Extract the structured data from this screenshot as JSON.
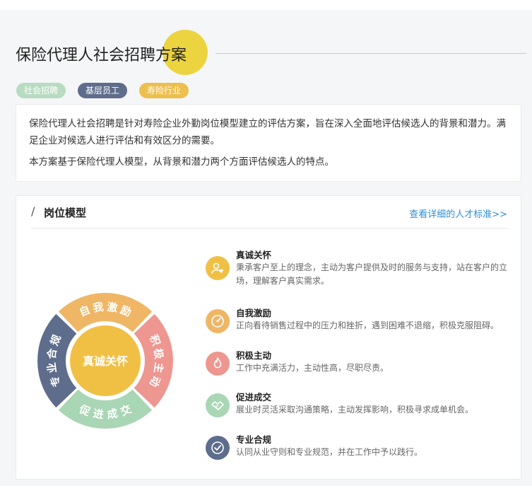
{
  "header": {
    "title": "保险代理人社会招聘方案",
    "tags": [
      {
        "label": "社会招聘",
        "bg": "#b8dcc2",
        "fg": "#ffffff"
      },
      {
        "label": "基层员工",
        "bg": "#5e6d8c",
        "fg": "#ffffff"
      },
      {
        "label": "寿险行业",
        "bg": "#edbf4e",
        "fg": "#ffffff"
      }
    ]
  },
  "intro": {
    "p1": "保险代理人社会招聘是针对寿险企业外勤岗位模型建立的评估方案，旨在深入全面地评估候选人的背景和潜力。满足企业对候选人进行评估和有效区分的需要。",
    "p2": "本方案基于保险代理人模型，从背景和潜力两个方面评估候选人的特点。"
  },
  "model": {
    "title": "岗位模型",
    "link": "查看详细的人才标准>>",
    "center_label": "真诚关怀",
    "center_color": "#f0c045",
    "ring": [
      {
        "label": "自我激励",
        "color": "#efb665"
      },
      {
        "label": "积极主动",
        "color": "#ee9690"
      },
      {
        "label": "促进成交",
        "color": "#a9d6b5"
      },
      {
        "label": "专业合规",
        "color": "#5e6d8c"
      }
    ],
    "traits": [
      {
        "name": "真诚关怀",
        "desc": "秉承客户至上的理念，主动为客户提供及时的服务与支持，站在客户的立场，理解客户真实需求。",
        "color": "#f0c045",
        "icon": "person-heart-icon"
      },
      {
        "name": "自我激励",
        "desc": "正向看待销售过程中的压力和挫折，遇到困难不退缩，积极克服阻碍。",
        "color": "#efb665",
        "icon": "gauge-icon"
      },
      {
        "name": "积极主动",
        "desc": "工作中充满活力，主动性高，尽职尽责。",
        "color": "#ee9690",
        "icon": "flame-icon"
      },
      {
        "name": "促进成交",
        "desc": "展业时灵活采取沟通策略，主动发挥影响，积极寻求成单机会。",
        "color": "#a9d6b5",
        "icon": "handshake-icon"
      },
      {
        "name": "专业合规",
        "desc": "认同从业守则和专业规范，并在工作中予以践行。",
        "color": "#5e6d8c",
        "icon": "check-badge-icon"
      }
    ]
  }
}
